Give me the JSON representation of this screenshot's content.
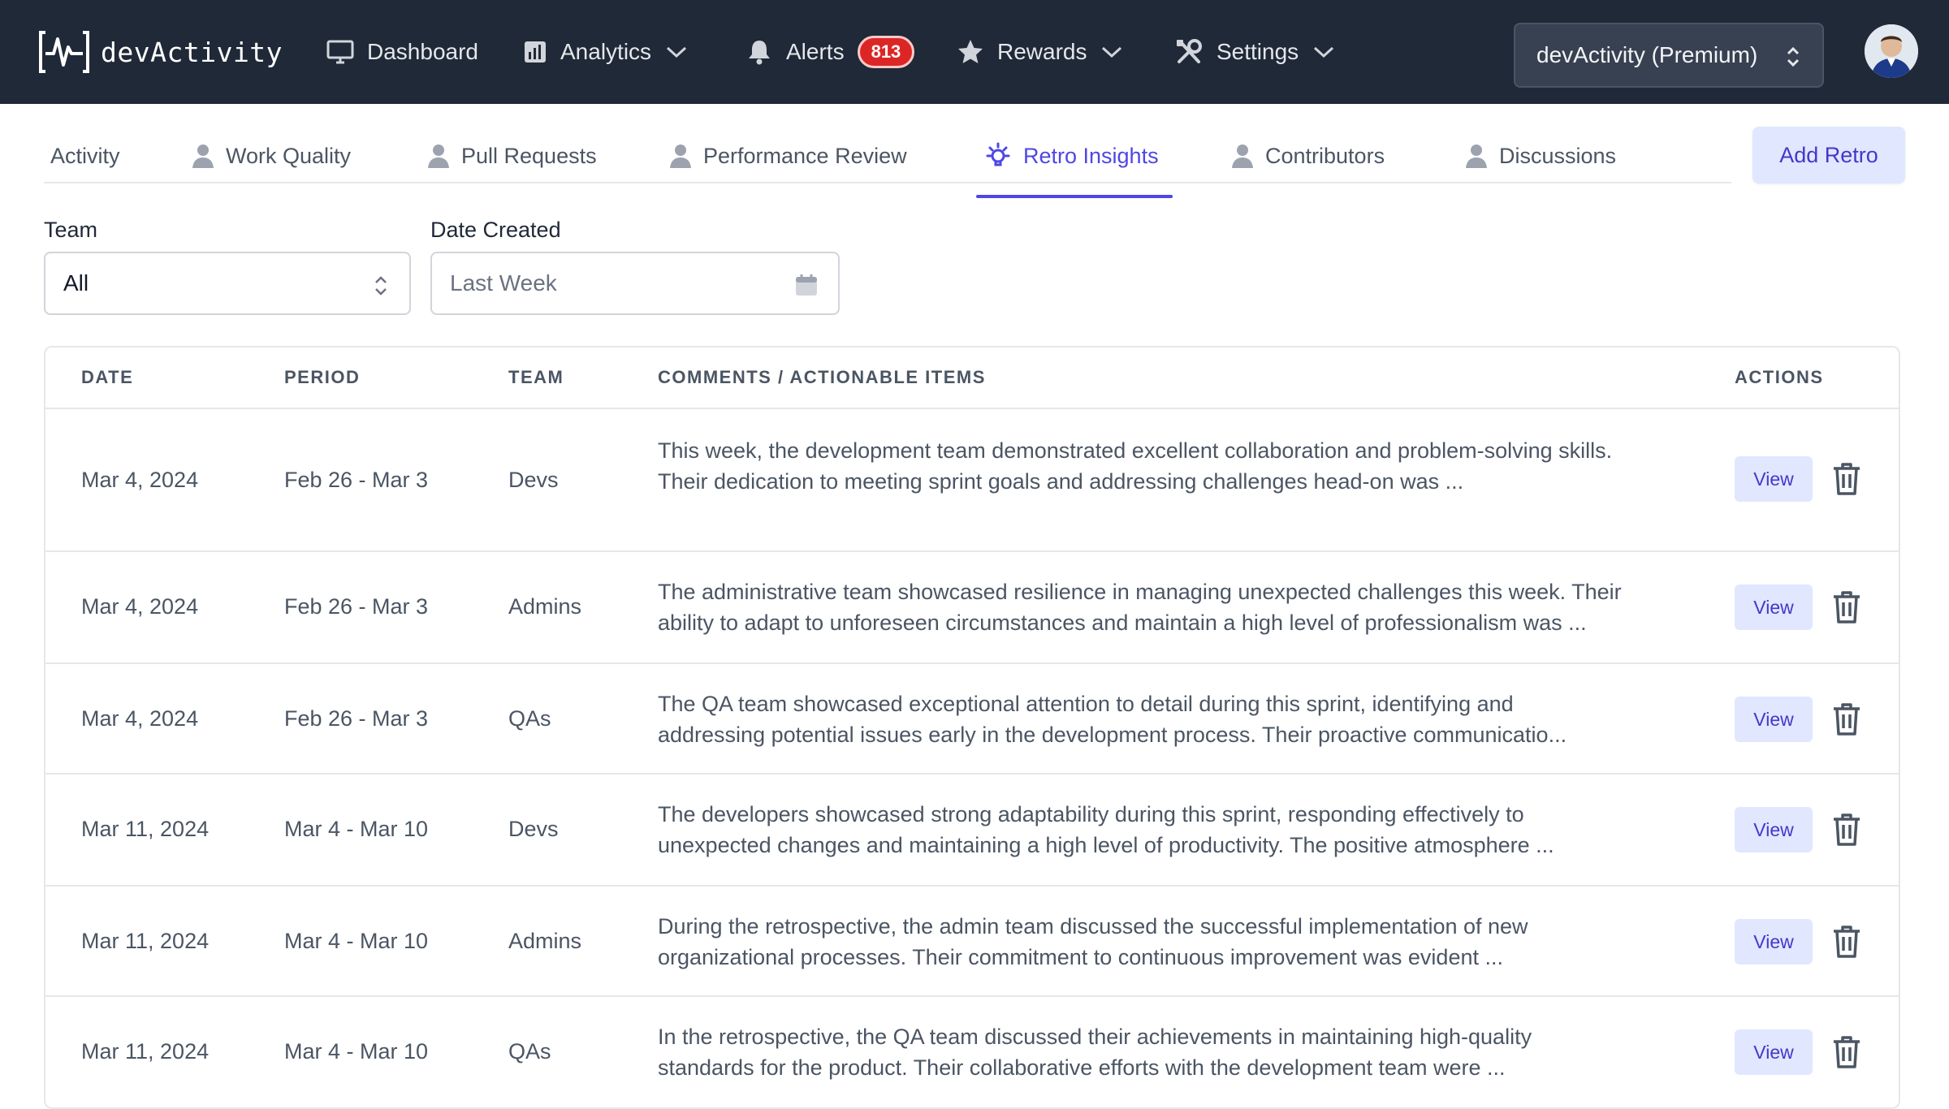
{
  "app": {
    "brand": "devActivity"
  },
  "nav": {
    "items": [
      {
        "label": "Dashboard",
        "icon": "monitor-icon"
      },
      {
        "label": "Analytics",
        "icon": "bar-chart-icon"
      },
      {
        "label": "Alerts",
        "icon": "bell-icon",
        "badge": "813"
      },
      {
        "label": "Rewards",
        "icon": "star-icon"
      },
      {
        "label": "Settings",
        "icon": "tools-icon"
      }
    ],
    "org_selector": "devActivity (Premium)"
  },
  "tabs": [
    {
      "label": "Activity",
      "active": false
    },
    {
      "label": "Work Quality",
      "active": false
    },
    {
      "label": "Pull Requests",
      "active": false
    },
    {
      "label": "Performance Review",
      "active": false
    },
    {
      "label": "Retro Insights",
      "active": true
    },
    {
      "label": "Contributors",
      "active": false
    },
    {
      "label": "Discussions",
      "active": false
    }
  ],
  "add_retro_label": "Add Retro",
  "filters": {
    "team_label": "Team",
    "team_value": "All",
    "date_label": "Date Created",
    "date_placeholder": "Last Week"
  },
  "table": {
    "headers": [
      "DATE",
      "PERIOD",
      "TEAM",
      "COMMENTS / ACTIONABLE ITEMS",
      "ACTIONS"
    ],
    "view_label": "View",
    "rows": [
      {
        "date": "Mar 4, 2024",
        "period": "Feb 26 - Mar 3",
        "team": "Devs",
        "comment_line1": "This week, the development team demonstrated excellent collaboration and problem-solving skills.",
        "comment_line2": "Their dedication to meeting sprint goals and addressing challenges head-on was  ..."
      },
      {
        "date": "Mar 4, 2024",
        "period": "Feb 26 - Mar 3",
        "team": "Admins",
        "comment_line1": "The administrative team showcased resilience in managing unexpected challenges this week. Their",
        "comment_line2": "ability to adapt to unforeseen circumstances and maintain a high level of professionalism was ..."
      },
      {
        "date": "Mar 4, 2024",
        "period": "Feb 26 - Mar 3",
        "team": "QAs",
        "comment_line1": "The QA team showcased exceptional attention to detail during this sprint, identifying and",
        "comment_line2": "addressing potential issues early in the development process. Their proactive communicatio..."
      },
      {
        "date": "Mar 11, 2024",
        "period": "Mar 4 - Mar 10",
        "team": "Devs",
        "comment_line1": "The developers showcased strong adaptability during this sprint, responding effectively to",
        "comment_line2": "unexpected changes and maintaining a high level of productivity. The positive atmosphere  ..."
      },
      {
        "date": "Mar 11, 2024",
        "period": "Mar 4 - Mar 10",
        "team": "Admins",
        "comment_line1": "During the retrospective, the admin team discussed the successful implementation of new",
        "comment_line2": "organizational processes. Their commitment to continuous improvement was evident ..."
      },
      {
        "date": "Mar 11, 2024",
        "period": "Mar 4 - Mar 10",
        "team": "QAs",
        "comment_line1": "In the retrospective, the QA team discussed their achievements in maintaining high-quality",
        "comment_line2": "standards for the product. Their collaborative efforts with the development team were  ..."
      }
    ]
  },
  "colors": {
    "nav_bg": "#1f2937",
    "accent": "#4f46e5",
    "badge": "#dc2626",
    "button_bg": "#e0e7ff"
  }
}
